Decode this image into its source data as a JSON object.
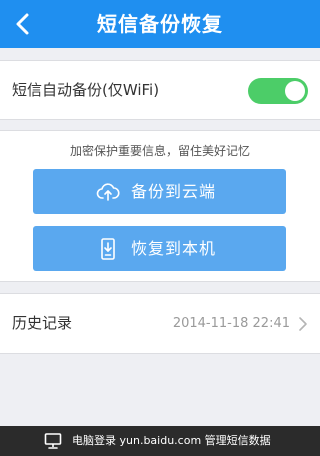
{
  "header": {
    "title": "短信备份恢复",
    "back_icon": "chevron-left-icon"
  },
  "auto_backup": {
    "label": "短信自动备份(仅WiFi)",
    "enabled": true,
    "toggle_color": "#4ccd68"
  },
  "backup": {
    "hint": "加密保护重要信息，留住美好记忆",
    "cloud_button": {
      "label": "备份到云端",
      "icon": "cloud-upload-icon"
    },
    "local_button": {
      "label": "恢复到本机",
      "icon": "phone-download-icon"
    },
    "button_color": "#5aa8ef"
  },
  "history": {
    "label": "历史记录",
    "last_time": "2014-11-18 22:41",
    "icon": "chevron-right-icon"
  },
  "footer": {
    "text": "电脑登录 yun.baidu.com 管理短信数据",
    "icon": "monitor-icon"
  },
  "colors": {
    "header": "#1f8ff0",
    "background": "#eeeff3"
  }
}
